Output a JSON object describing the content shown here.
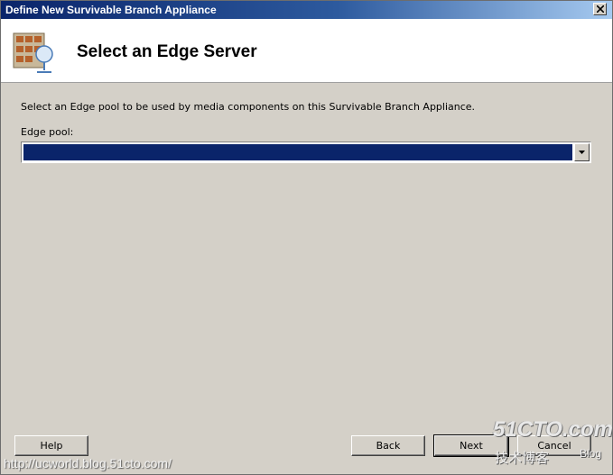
{
  "window": {
    "title": "Define New Survivable Branch Appliance"
  },
  "header": {
    "title": "Select an Edge Server",
    "icon": "server-appliance-icon"
  },
  "main": {
    "description": "Select an Edge pool to be used by media components on this Survivable Branch Appliance.",
    "edge_pool_label": "Edge pool:",
    "edge_pool_value": ""
  },
  "buttons": {
    "help": "Help",
    "back": "Back",
    "next": "Next",
    "cancel": "Cancel"
  },
  "watermark": {
    "url": "http://ucworld.blog.51cto.com/",
    "logo_main": "51CTO.com",
    "logo_sub": "技术博客",
    "logo_blog": "Blog"
  },
  "colors": {
    "titlebar": "#0a246a",
    "dialog_bg": "#d4d0c8",
    "selection": "#0a246a"
  }
}
